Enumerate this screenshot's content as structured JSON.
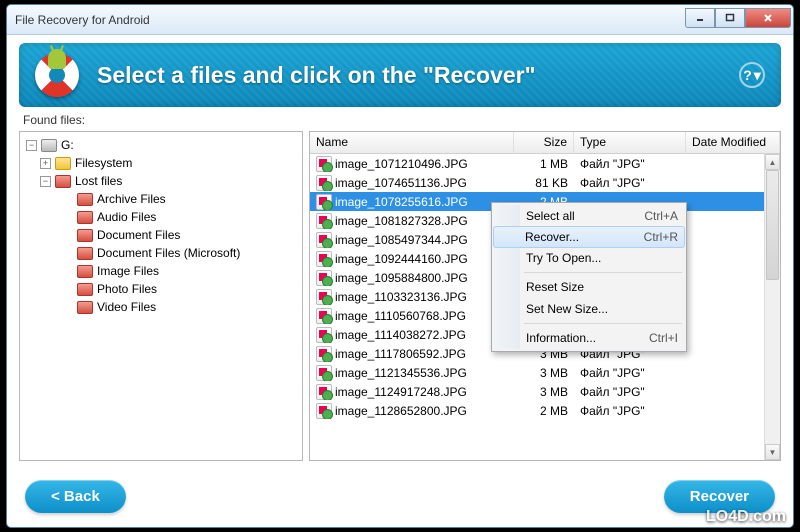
{
  "window": {
    "title": "File Recovery for Android"
  },
  "banner": {
    "title": "Select a files and click on the \"Recover\""
  },
  "found_label": "Found files:",
  "tree": {
    "drive": "G:",
    "filesystem": "Filesystem",
    "lostfiles": "Lost files",
    "categories": [
      "Archive Files",
      "Audio Files",
      "Document Files",
      "Document Files (Microsoft)",
      "Image Files",
      "Photo Files",
      "Video Files"
    ]
  },
  "columns": {
    "name": "Name",
    "size": "Size",
    "type": "Type",
    "date": "Date Modified"
  },
  "type_label": "Файл \"JPG\"",
  "files": [
    {
      "name": "image_1071210496.JPG",
      "size": "1 MB"
    },
    {
      "name": "image_1074651136.JPG",
      "size": "81 KB"
    },
    {
      "name": "image_1078255616.JPG",
      "size": "2 MB",
      "selected": true
    },
    {
      "name": "image_1081827328.JPG",
      "size": ""
    },
    {
      "name": "image_1085497344.JPG",
      "size": ""
    },
    {
      "name": "image_1092444160.JPG",
      "size": ""
    },
    {
      "name": "image_1095884800.JPG",
      "size": ""
    },
    {
      "name": "image_1103323136.JPG",
      "size": ""
    },
    {
      "name": "image_1110560768.JPG",
      "size": ""
    },
    {
      "name": "image_1114038272.JPG",
      "size": ""
    },
    {
      "name": "image_1117806592.JPG",
      "size": "3 MB"
    },
    {
      "name": "image_1121345536.JPG",
      "size": "3 MB"
    },
    {
      "name": "image_1124917248.JPG",
      "size": "3 MB"
    },
    {
      "name": "image_1128652800.JPG",
      "size": "2 MB"
    }
  ],
  "show_type_for": [
    0,
    1,
    10,
    11,
    12,
    13
  ],
  "context_menu": [
    {
      "label": "Select all",
      "shortcut": "Ctrl+A"
    },
    {
      "label": "Recover...",
      "shortcut": "Ctrl+R",
      "hover": true
    },
    {
      "label": "Try To Open..."
    },
    {
      "sep": true
    },
    {
      "label": "Reset Size"
    },
    {
      "label": "Set New Size..."
    },
    {
      "sep": true
    },
    {
      "label": "Information...",
      "shortcut": "Ctrl+I"
    }
  ],
  "buttons": {
    "back": "<  Back",
    "recover": "Recover"
  },
  "watermark": "LO4D.com"
}
